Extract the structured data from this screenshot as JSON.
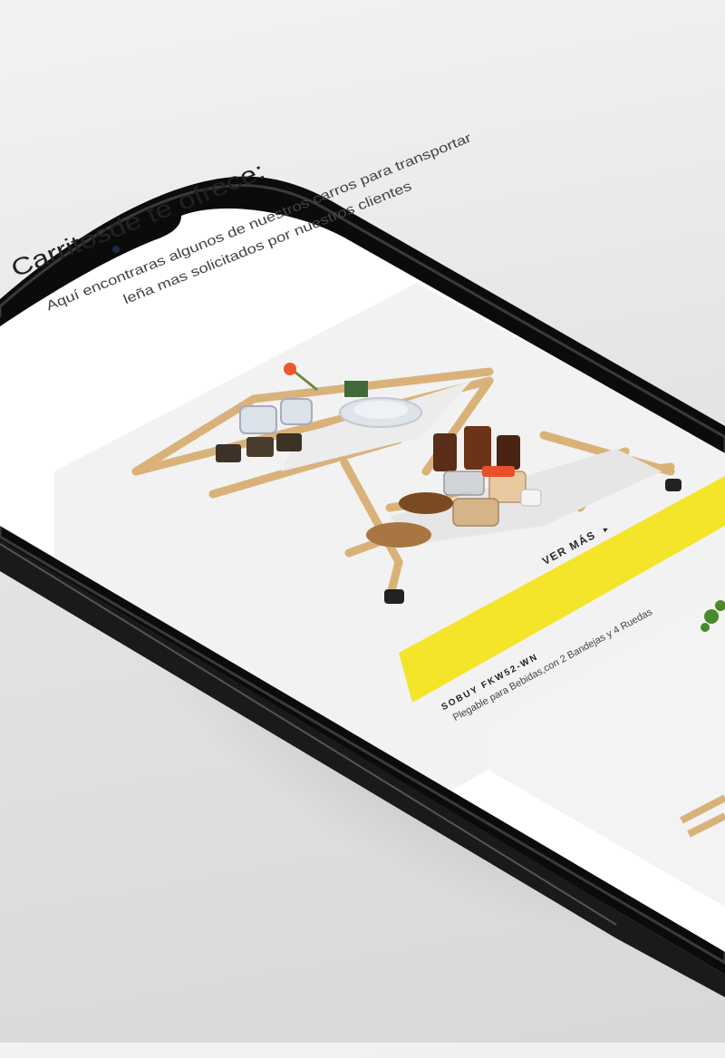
{
  "page": {
    "heading": "Carritosde te ofrece:",
    "subtext_line1": "Aquí encontraras algunos de nuestros carros para transportar",
    "subtext_line2": "leña mas solicitados por nuestros clientes"
  },
  "product": {
    "cta_label": "VER MÁS",
    "cta_arrow": "▸",
    "name": "SOBUY FKW52-WN",
    "description": "Plegable para Bebidas,con 2 Bandejas y 4 Ruedas"
  },
  "colors": {
    "accent": "#f4e52a",
    "phone_body": "#101010",
    "screen_bg": "#ffffff"
  }
}
